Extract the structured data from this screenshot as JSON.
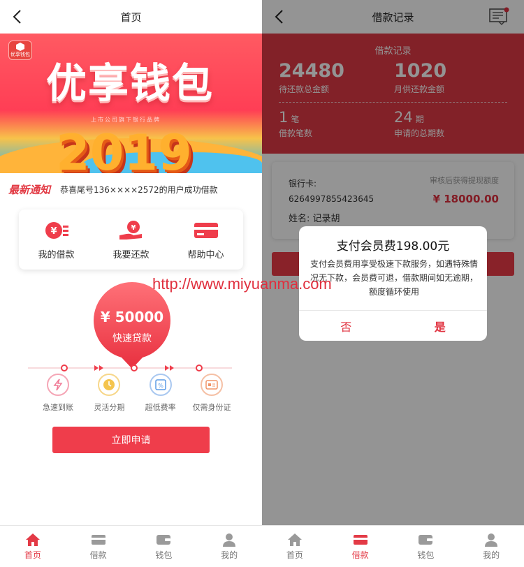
{
  "left": {
    "nav_title": "首页",
    "banner": {
      "badge": "优享钱包",
      "headline": "优享钱包",
      "subline": "上市公司旗下银行品牌",
      "year": "2019"
    },
    "notice": {
      "tag": "最新通知",
      "message": "恭喜尾号136××××2572的用户成功借款"
    },
    "actions": [
      {
        "label": "我的借款",
        "icon": "loan-yen-icon"
      },
      {
        "label": "我要还款",
        "icon": "repay-hand-icon"
      },
      {
        "label": "帮助中心",
        "icon": "card-icon"
      }
    ],
    "loan": {
      "amount": "¥ 50000",
      "label": "快速贷款"
    },
    "features": [
      {
        "label": "急速到账",
        "icon": "lightning-icon",
        "color": "#f07a96"
      },
      {
        "label": "灵活分期",
        "icon": "clock-icon",
        "color": "#f4c44e"
      },
      {
        "label": "超低费率",
        "icon": "rate-icon",
        "color": "#5b9be6"
      },
      {
        "label": "仅需身份证",
        "icon": "id-card-icon",
        "color": "#f0956a"
      }
    ],
    "apply_label": "立即申请",
    "tabs": [
      {
        "label": "首页",
        "icon": "home-icon",
        "active": true
      },
      {
        "label": "借款",
        "icon": "wallet-card-icon",
        "active": false
      },
      {
        "label": "钱包",
        "icon": "wallet-icon",
        "active": false
      },
      {
        "label": "我的",
        "icon": "user-icon",
        "active": false
      }
    ]
  },
  "right": {
    "nav_title": "借款记录",
    "header_title": "借款记录",
    "stats": {
      "pending_total": "24480",
      "pending_total_caption": "待还款总金额",
      "monthly": "1020",
      "monthly_caption": "月供还款金额",
      "count": "1",
      "count_unit": "笔",
      "count_caption": "借款笔数",
      "periods": "24",
      "periods_unit": "期",
      "periods_caption": "申请的总期数"
    },
    "card": {
      "bank_label": "银行卡:",
      "bank_number": "6264997855423645",
      "name": "姓名: 记录胡",
      "note": "审核后获得提现额度",
      "amount": "¥ 18000.00"
    },
    "modal": {
      "title": "支付会员费198.00元",
      "body": "支付会员费用享受极速下款服务，如遇特殊情况无下款，会员费可退，借款期间如无逾期，额度循环使用",
      "no": "否",
      "yes": "是"
    },
    "tabs": [
      {
        "label": "首页",
        "icon": "home-icon",
        "active": false
      },
      {
        "label": "借款",
        "icon": "wallet-card-icon",
        "active": true
      },
      {
        "label": "钱包",
        "icon": "wallet-icon",
        "active": false
      },
      {
        "label": "我的",
        "icon": "user-icon",
        "active": false
      }
    ]
  },
  "watermark": "http://www.miyuanma.com",
  "colors": {
    "accent": "#e0303e",
    "tab_inactive": "#999999"
  }
}
